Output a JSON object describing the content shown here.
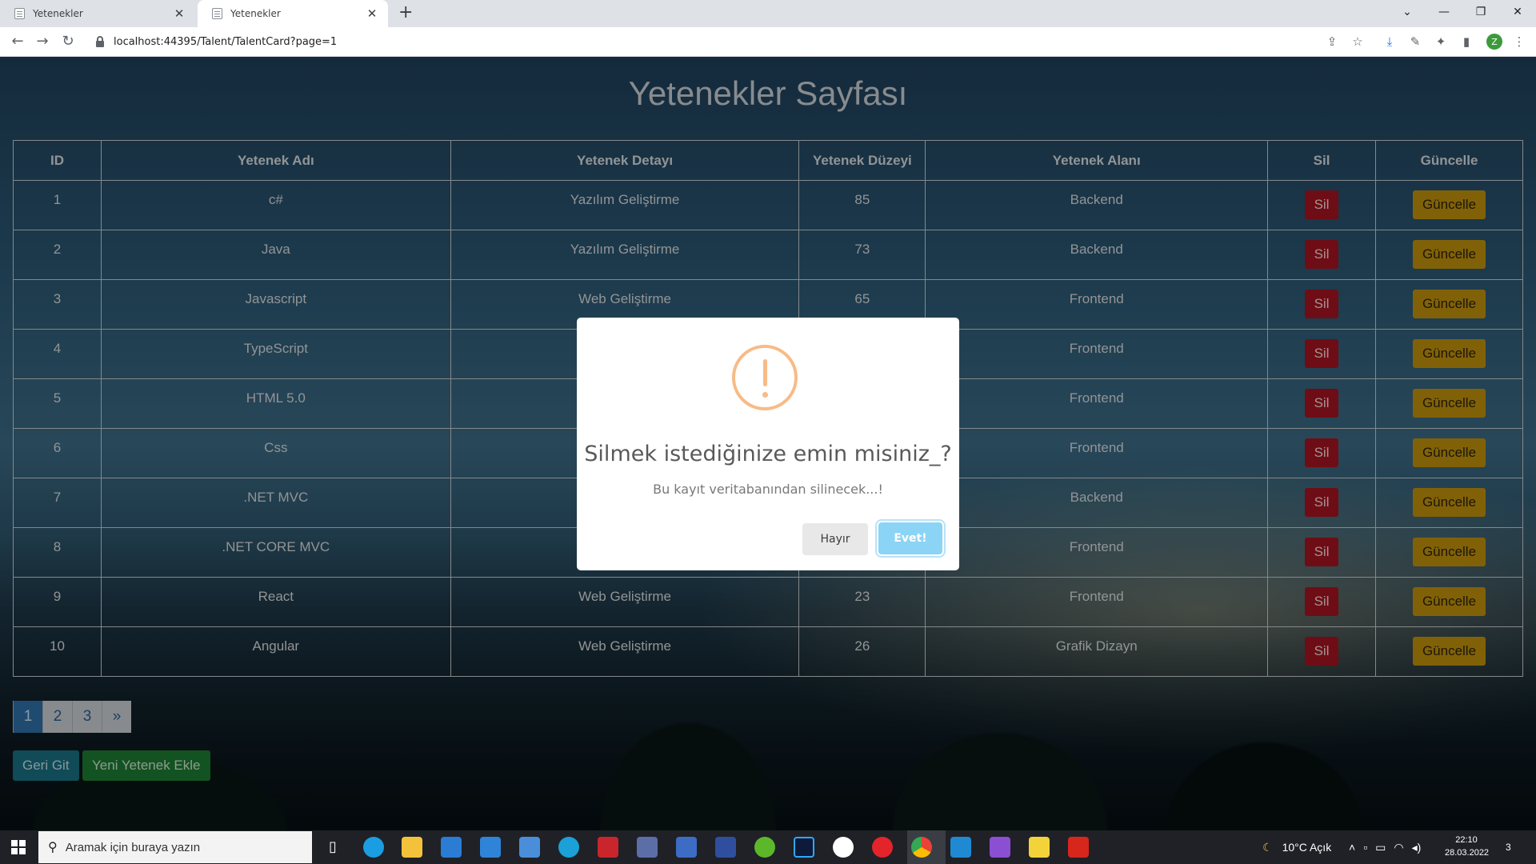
{
  "browser": {
    "tabs": [
      {
        "title": "Yetenekler",
        "active": false
      },
      {
        "title": "Yetenekler",
        "active": true
      }
    ],
    "url": "localhost:44395/Talent/TalentCard?page=1"
  },
  "page": {
    "title": "Yetenekler Sayfası",
    "columns": [
      "ID",
      "Yetenek Adı",
      "Yetenek Detayı",
      "Yetenek Düzeyi",
      "Yetenek Alanı",
      "Sil",
      "Güncelle"
    ],
    "rows": [
      {
        "id": "1",
        "name": "c#",
        "detail": "Yazılım Geliştirme",
        "level": "85",
        "area": "Backend"
      },
      {
        "id": "2",
        "name": "Java",
        "detail": "Yazılım Geliştirme",
        "level": "73",
        "area": "Backend"
      },
      {
        "id": "3",
        "name": "Javascript",
        "detail": "Web Geliştirme",
        "level": "65",
        "area": "Frontend"
      },
      {
        "id": "4",
        "name": "TypeScript",
        "detail": "",
        "level": "",
        "area": "Frontend"
      },
      {
        "id": "5",
        "name": "HTML 5.0",
        "detail": "",
        "level": "",
        "area": "Frontend"
      },
      {
        "id": "6",
        "name": "Css",
        "detail": "",
        "level": "",
        "area": "Frontend"
      },
      {
        "id": "7",
        "name": ".NET MVC",
        "detail": "",
        "level": "",
        "area": "Backend"
      },
      {
        "id": "8",
        "name": ".NET CORE MVC",
        "detail": "",
        "level": "",
        "area": "Frontend"
      },
      {
        "id": "9",
        "name": "React",
        "detail": "Web Geliştirme",
        "level": "23",
        "area": "Frontend"
      },
      {
        "id": "10",
        "name": "Angular",
        "detail": "Web Geliştirme",
        "level": "26",
        "area": "Grafik Dizayn"
      }
    ],
    "delete_label": "Sil",
    "update_label": "Güncelle",
    "pagination": [
      "1",
      "2",
      "3",
      "»"
    ],
    "back_button": "Geri Git",
    "add_button": "Yeni Yetenek Ekle"
  },
  "modal": {
    "icon": "warning-icon",
    "title": "Silmek istediğinize emin misiniz_?",
    "text": "Bu kayıt veritabanından silinecek...!",
    "cancel": "Hayır",
    "confirm": "Evet!"
  },
  "taskbar": {
    "search_placeholder": "Aramak için buraya yazın",
    "weather": "10°C  Açık",
    "time": "22:10",
    "date": "28.03.2022",
    "notifications": "3"
  },
  "colors": {
    "delete": "#a31420",
    "update": "#bf8f0c",
    "back": "#186f80",
    "add": "#1d7a32",
    "confirm": "#8cd4f5",
    "warning": "#f8bb86"
  }
}
